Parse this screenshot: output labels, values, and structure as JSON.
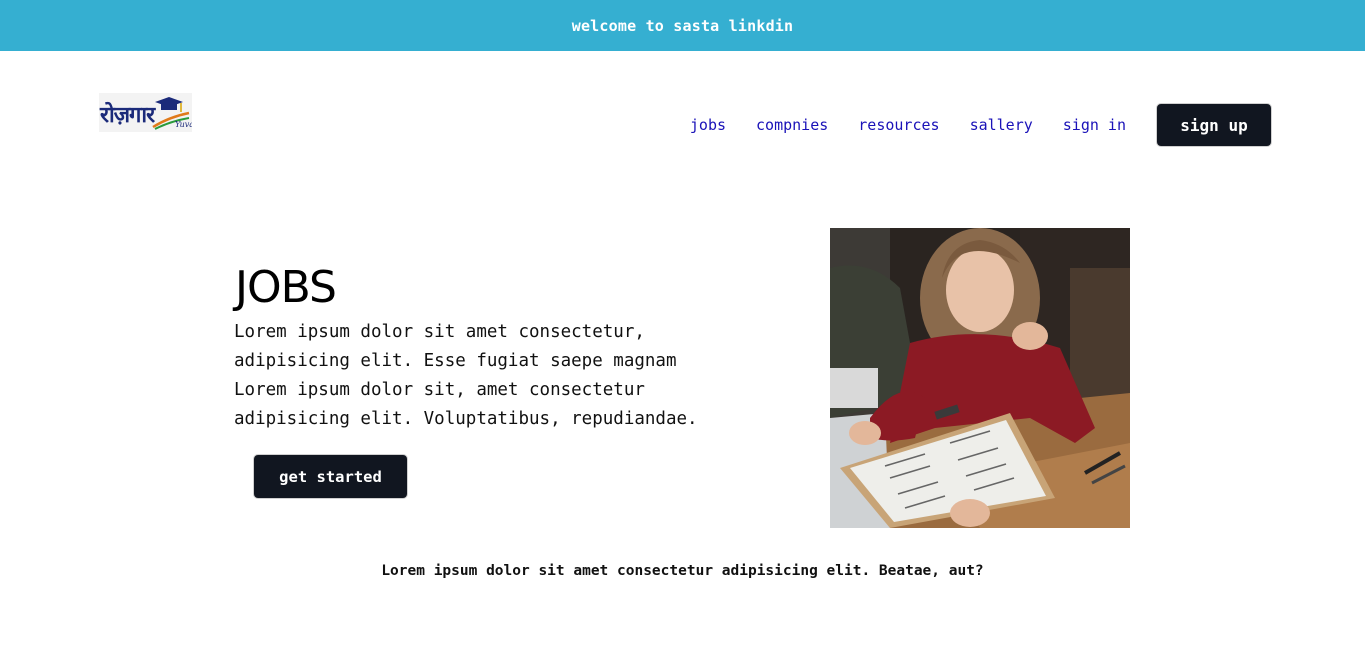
{
  "banner": {
    "text": "welcome to sasta linkdin"
  },
  "logo": {
    "text_main": "रोज़गार",
    "text_sub": "Yuva"
  },
  "nav": {
    "links": [
      "jobs",
      "compnies",
      "resources",
      "sallery",
      "sign in"
    ],
    "signup_label": "sign up"
  },
  "hero": {
    "title": "JOBS",
    "lines": [
      "Lorem ipsum dolor sit amet consectetur,",
      "adipisicing elit. Esse fugiat saepe magnam",
      "Lorem ipsum dolor sit, amet consectetur",
      "adipisicing elit. Voluptatibus, repudiandae."
    ],
    "cta_label": "get started"
  },
  "tagline": "Lorem ipsum dolor sit amet consectetur adipisicing elit. Beatae, aut?",
  "colors": {
    "banner": "#35afd1",
    "nav_link": "#1a12b8",
    "button": "#111620"
  }
}
